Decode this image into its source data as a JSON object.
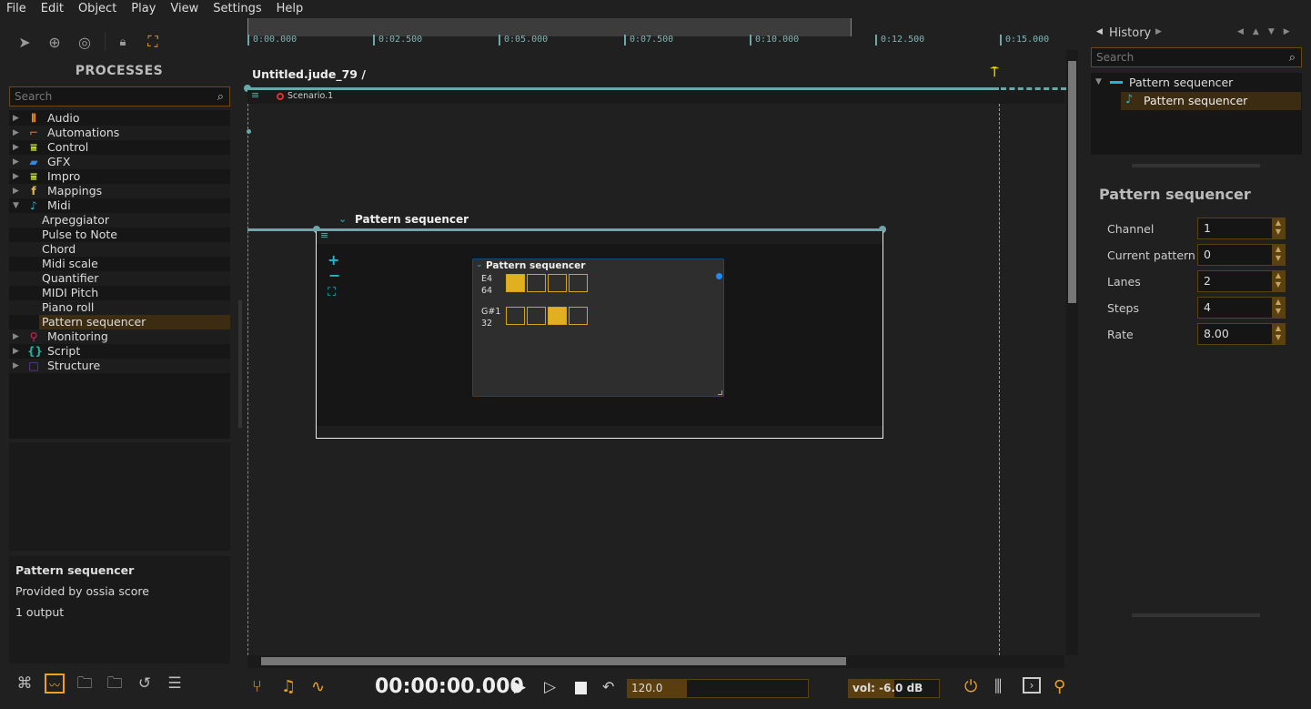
{
  "menu": [
    "File",
    "Edit",
    "Object",
    "Play",
    "View",
    "Settings",
    "Help"
  ],
  "left": {
    "title": "PROCESSES",
    "search_placeholder": "Search",
    "categories": [
      {
        "label": "Audio",
        "icon": "audio-icon",
        "color": "#f08a1c"
      },
      {
        "label": "Automations",
        "icon": "automation-icon",
        "color": "#e84a2a"
      },
      {
        "label": "Control",
        "icon": "sliders-icon",
        "color": "#b6d22a"
      },
      {
        "label": "GFX",
        "icon": "clapper-icon",
        "color": "#2a8ae0"
      },
      {
        "label": "Impro",
        "icon": "sliders-icon",
        "color": "#b6d22a"
      },
      {
        "label": "Mappings",
        "icon": "fx-icon",
        "color": "#e0c030"
      },
      {
        "label": "Midi",
        "icon": "note-icon",
        "color": "#20b8d0"
      }
    ],
    "midi_items": [
      "Arpeggiator",
      "Pulse to Note",
      "Chord",
      "Midi scale",
      "Quantifier",
      "MIDI Pitch",
      "Piano roll",
      "Pattern sequencer"
    ],
    "categories_after": [
      {
        "label": "Monitoring",
        "icon": "magnifier-icon",
        "color": "#e02060"
      },
      {
        "label": "Script",
        "icon": "braces-icon",
        "color": "#20b0a0"
      },
      {
        "label": "Structure",
        "icon": "square-icon",
        "color": "#7040c0"
      }
    ],
    "info": {
      "name": "Pattern sequencer",
      "provider": "Provided by ossia score",
      "outputs": "1 output"
    }
  },
  "timeline": {
    "ticks": [
      "0:00.000",
      "0:02.500",
      "0:05.000",
      "0:07.500",
      "0:10.000",
      "0:12.500",
      "0:15.000"
    ],
    "document_title": "Untitled.jude_79 /",
    "scenario": "Scenario.1",
    "interval_label": "Pattern sequencer",
    "node": {
      "title": "Pattern sequencer",
      "lanes": [
        {
          "note": "E4",
          "velocity": "64",
          "steps": [
            true,
            false,
            false,
            false
          ]
        },
        {
          "note": "G#1",
          "velocity": "32",
          "steps": [
            false,
            false,
            true,
            false
          ]
        }
      ]
    }
  },
  "transport": {
    "time": "00:00:00.000",
    "tempo": "120.0",
    "tempo_fraction": 0.33,
    "volume": "vol: -6.0 dB",
    "volume_fraction": 0.5
  },
  "right": {
    "tab": "History",
    "search_placeholder": "Search",
    "tree": {
      "parent": "Pattern sequencer",
      "child": "Pattern sequencer"
    },
    "inspector_title": "Pattern sequencer",
    "params": [
      {
        "label": "Channel",
        "value": "1"
      },
      {
        "label": "Current pattern",
        "value": "0"
      },
      {
        "label": "Lanes",
        "value": "2"
      },
      {
        "label": "Steps",
        "value": "4"
      },
      {
        "label": "Rate",
        "value": "8.00"
      }
    ]
  },
  "colors": {
    "accent": "#f0a020",
    "timeline": "#6aa9aa",
    "selection": "#3c2c12",
    "step_on": "#e0b020"
  }
}
